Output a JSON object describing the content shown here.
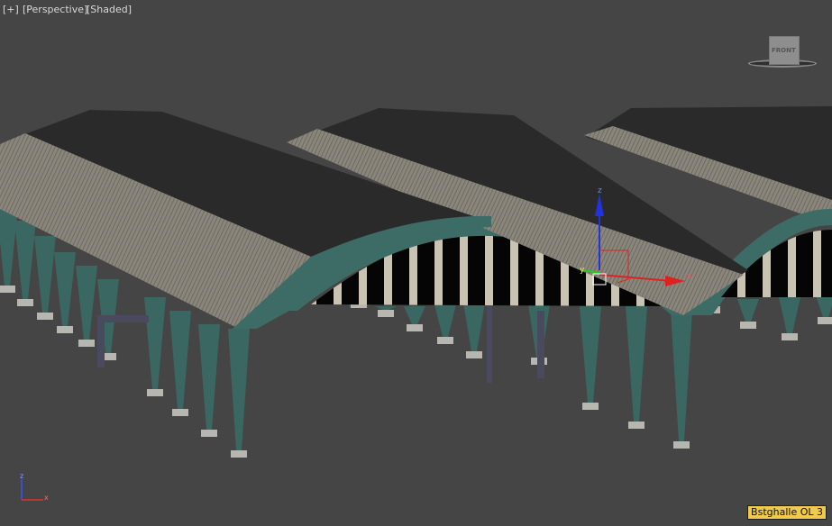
{
  "viewport": {
    "menu_plus": "[+]",
    "view_mode": "[Perspective]",
    "shading_mode": "[Shaded]"
  },
  "viewcube": {
    "face_label": "FRONT"
  },
  "gizmo": {
    "x_label": "x",
    "y_label": "y",
    "z_label": "z"
  },
  "world_axis": {
    "x_label": "x",
    "z_label": "z"
  },
  "selected_object": "Bstghalle OL 3",
  "colors": {
    "background": "#454545",
    "steel": "#3d6b66",
    "roof_dark": "#2b2b2b",
    "roof_slab": "#8c887e",
    "tag": "#f0c94f"
  }
}
